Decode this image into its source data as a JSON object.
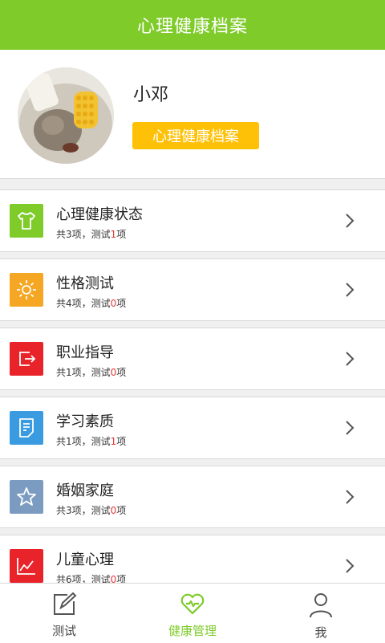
{
  "header": {
    "title": "心理健康档案"
  },
  "profile": {
    "name": "小邓",
    "archive_button": "心理健康档案"
  },
  "items": [
    {
      "title": "心理健康状态",
      "pre": "共3项，测试",
      "count": "1",
      "post": "项",
      "icon": "shirt-icon",
      "color": "#7ecb2a"
    },
    {
      "title": "性格测试",
      "pre": "共4项，测试",
      "count": "0",
      "post": "项",
      "icon": "sun-icon",
      "color": "#f5a623"
    },
    {
      "title": "职业指导",
      "pre": "共1项，测试",
      "count": "0",
      "post": "项",
      "icon": "exit-icon",
      "color": "#e8232a"
    },
    {
      "title": "学习素质",
      "pre": "共1项，测试",
      "count": "1",
      "post": "项",
      "icon": "document-icon",
      "color": "#3a9be0"
    },
    {
      "title": "婚姻家庭",
      "pre": "共3项，测试",
      "count": "0",
      "post": "项",
      "icon": "star-icon",
      "color": "#7b9cc0"
    },
    {
      "title": "儿童心理",
      "pre": "共6项，测试",
      "count": "0",
      "post": "项",
      "icon": "chart-icon",
      "color": "#e8232a"
    }
  ],
  "tabs": [
    {
      "label": "测试",
      "icon": "edit-icon",
      "active": false
    },
    {
      "label": "健康管理",
      "icon": "heart-icon",
      "active": true
    },
    {
      "label": "我",
      "icon": "user-icon",
      "active": false
    }
  ],
  "colors": {
    "brand": "#7ecb2a",
    "accent": "#ffc107",
    "highlight": "#e53935"
  }
}
